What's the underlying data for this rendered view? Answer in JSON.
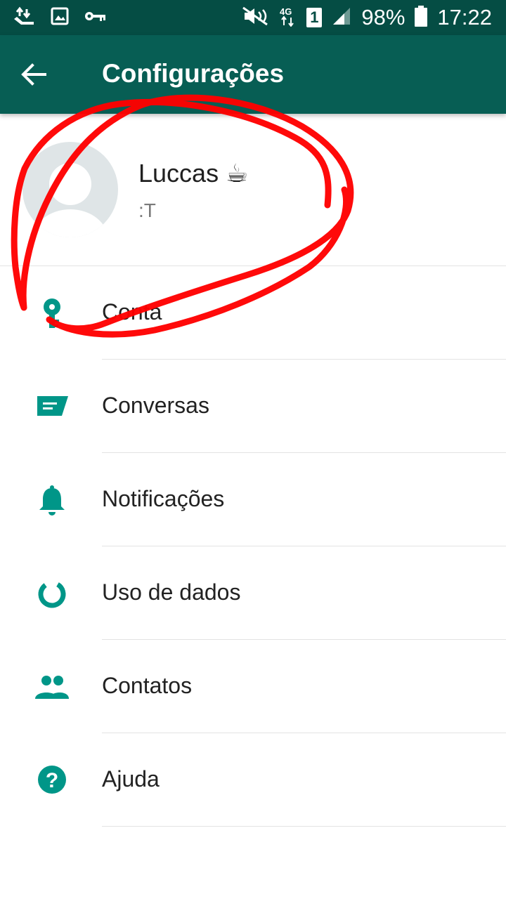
{
  "status_bar": {
    "battery": "98%",
    "time": "17:22",
    "network": "4G",
    "sim": "1",
    "icons": [
      "sync-icon",
      "gallery-icon",
      "key-icon",
      "mute-icon",
      "network-4g-icon",
      "sim-1-icon",
      "signal-icon",
      "battery-icon"
    ]
  },
  "app_bar": {
    "title": "Configurações",
    "back_icon": "arrow-back-icon"
  },
  "profile": {
    "name": "Luccas ☕",
    "status": ":T"
  },
  "settings": {
    "items": [
      {
        "label": "Conta",
        "icon": "key-icon"
      },
      {
        "label": "Conversas",
        "icon": "chat-icon"
      },
      {
        "label": "Notificações",
        "icon": "bell-icon"
      },
      {
        "label": "Uso de dados",
        "icon": "data-usage-icon"
      },
      {
        "label": "Contatos",
        "icon": "contacts-icon"
      },
      {
        "label": "Ajuda",
        "icon": "help-icon"
      }
    ]
  },
  "colors": {
    "statusbar": "#054d44",
    "appbar": "#075e54",
    "icon_accent": "#009688",
    "annotation": "#ff0000"
  }
}
